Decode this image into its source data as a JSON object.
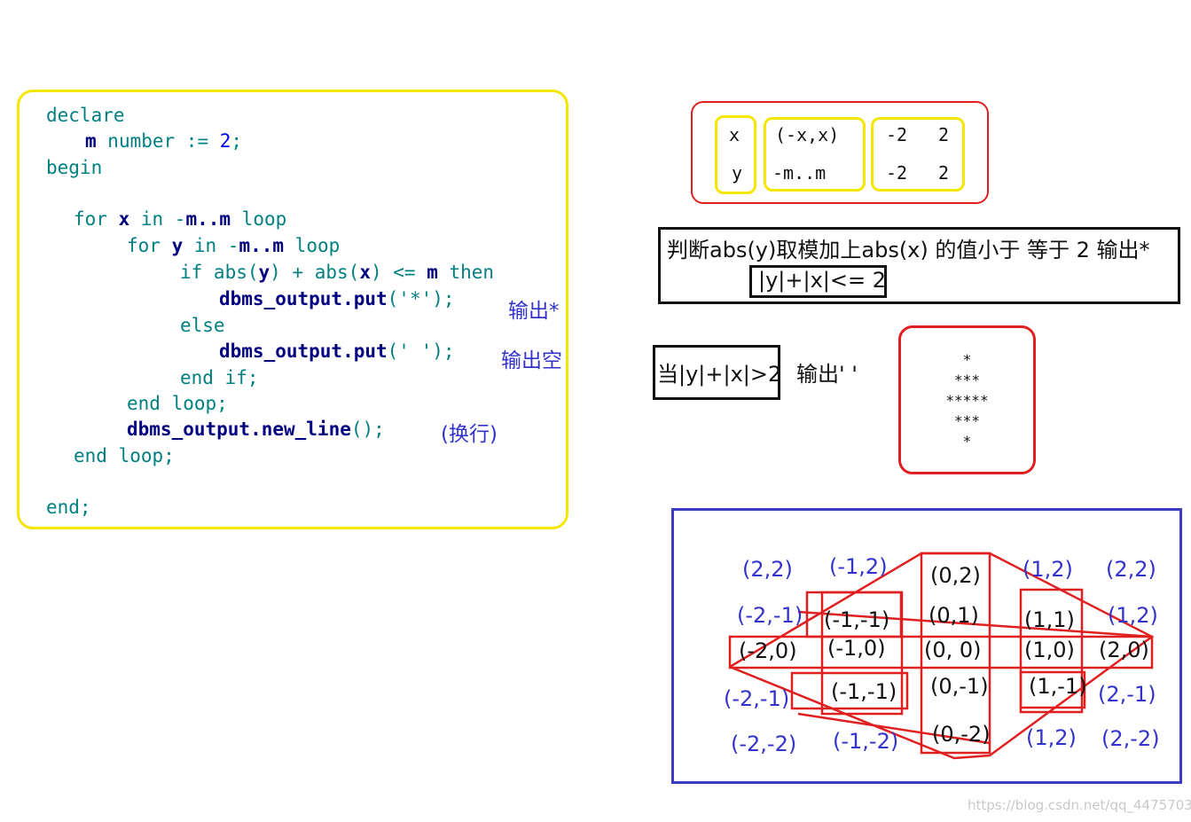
{
  "code": {
    "l1": "declare",
    "l2_var": "m",
    "l2_rest": " number := ",
    "l2_val": "2",
    "l2_end": ";",
    "l3": "begin",
    "l4_kw": "for ",
    "l4_var": "x",
    "l4_in": " in -",
    "l4_range": "m..m",
    "l4_loop": " loop",
    "l5_kw": "for ",
    "l5_var": "y",
    "l5_in": " in -",
    "l5_range": "m..m",
    "l5_loop": " loop",
    "l6_a": "if abs(",
    "l6_y": "y",
    "l6_b": ") + abs(",
    "l6_x": "x",
    "l6_c": ") <= ",
    "l6_m": "m",
    "l6_d": " then",
    "l7_fn": "dbms_output.put",
    "l7_arg": "('*');",
    "l8": "else",
    "l9_fn": "dbms_output.put",
    "l9_arg": "(' ');",
    "l10": "end if;",
    "l11": "end loop;",
    "l12_fn": "dbms_output.new_line",
    "l12_arg": "();",
    "l13": "end loop;",
    "l14": "end;"
  },
  "annotations": {
    "output_star": "输出*",
    "output_space": "输出空",
    "newline": "(换行)"
  },
  "range_table": {
    "row1": [
      "x",
      "(-x,x)",
      "-2",
      "2"
    ],
    "row2": [
      "y",
      "-m..m",
      "-2",
      "2"
    ]
  },
  "rule": {
    "text": "判断abs(y)取模加上abs(x) 的值小于 等于 2  输出*",
    "condition": "|y|+|x|<= 2",
    "else_condition": "当|y|+|x|>2",
    "else_output": "输出' '"
  },
  "star_output": [
    "*",
    "***",
    "*****",
    "***",
    "*"
  ],
  "grid": {
    "row1": [
      "(2,2)",
      "(-1,2)",
      "(0,2)",
      "(1,2)",
      "(2,2)"
    ],
    "row2": [
      "(-2,-1)",
      "(-1,-1)",
      "(0,1)",
      "(1,1)",
      "(1,2)"
    ],
    "row3": [
      "(-2,0)",
      "(-1,0)",
      "(0,  0)",
      "(1,0)",
      "(2,0)"
    ],
    "row4": [
      "(-2,-1)",
      "(-1,-1)",
      "(0,-1)",
      "(1,-1)",
      "(2,-1)"
    ],
    "row5": [
      "(-2,-2)",
      "(-1,-2)",
      "(0,-2)",
      "(1,2)",
      "(2,-2)"
    ]
  },
  "colors": {
    "code_border": "#f5e600",
    "red_lines": "#e02020",
    "grid_border": "#3c3cc0",
    "annotation_text": "#3333cc"
  },
  "watermark": "https://blog.csdn.net/qq_44757034"
}
